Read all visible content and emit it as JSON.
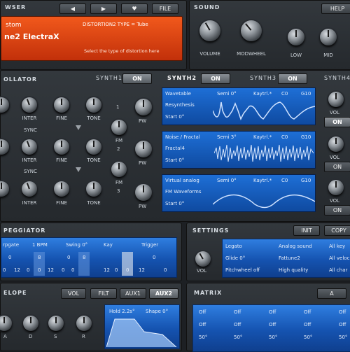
{
  "browser": {
    "title": "WSER",
    "back_label": "◀",
    "forward_label": "▶",
    "heart_label": "♥",
    "file_label": "FILE",
    "preset_category": "stom",
    "preset_name": "ne2 ElectraX",
    "param_text": "DISTORTION2 TYPE = Tube",
    "hint_text": "Select the type of distortion here"
  },
  "sound": {
    "title": "SOUND",
    "help_label": "HELP",
    "knobs": [
      "VOLUME",
      "MODWHEEL",
      "LOW",
      "MID"
    ]
  },
  "oscillator": {
    "title": "OLLATOR",
    "synth_tabs": [
      {
        "label": "SYNTH1",
        "state": "ON"
      },
      {
        "label": "SYNTH2",
        "state": "ON"
      },
      {
        "label": "SYNTH3",
        "state": "ON"
      },
      {
        "label": "SYNTH4",
        "state": ""
      }
    ],
    "rows": [
      {
        "knobs": [
          "INTER",
          "FINE",
          "TONE"
        ]
      },
      {
        "sync": "SYNC",
        "knobs": [
          "INTER",
          "FINE",
          "TONE"
        ]
      },
      {
        "sync": "SYNC",
        "knobs": [
          "INTER",
          "FINE",
          "TONE"
        ]
      }
    ],
    "pw_label": "PW",
    "fm_labels": [
      "FM\n2",
      "FM\n3"
    ],
    "fm_numbers": [
      "1",
      "2",
      "3"
    ],
    "osc_panels": [
      {
        "type": "Wavetable",
        "semi": "Semi 0°",
        "keytrk": "Kaytrl.*",
        "c0": "C0",
        "g10": "G10",
        "name": "Resynthesis",
        "start": "Start 0°"
      },
      {
        "type": "Noise / Fractal",
        "semi": "Semi 3°",
        "keytrk": "Kaytrl.*",
        "c0": "C0",
        "g10": "G10",
        "name": "Fractal4",
        "start": "Start 0°"
      },
      {
        "type": "Virtual analog",
        "semi": "Semi 0°",
        "keytrk": "Kaytrl.*",
        "c0": "C0",
        "g10": "G10",
        "name": "FM Waveforms",
        "start": "Start 0°"
      }
    ],
    "vol_label": "VOL",
    "on_label": "ON"
  },
  "arpeggiator": {
    "title": "PEGGIATOR",
    "headers": [
      "rpgate",
      "1 BPM",
      "Swing 0°",
      "Kay",
      "Trigger"
    ],
    "row1": [
      "0",
      "8",
      "0",
      "8",
      "0"
    ],
    "row2": [
      "0",
      "12",
      "0",
      "0",
      "12",
      "0",
      "0",
      "12",
      "0",
      "0",
      "12",
      "0"
    ]
  },
  "settings": {
    "title": "SETTINGS",
    "init_label": "INIT",
    "copy_label": "COPY",
    "vol_label": "VOL",
    "rows": [
      [
        "Legato",
        "Analog sound",
        "All key"
      ],
      [
        "Glide 0°",
        "Fattune2",
        "All veloc"
      ],
      [
        "Pitchwheel off",
        "High quality",
        "All char"
      ]
    ]
  },
  "envelope": {
    "title": "ELOPE",
    "tabs": [
      "VOL",
      "FILT",
      "AUX1",
      "AUX2"
    ],
    "knobs": [
      "A",
      "D",
      "S",
      "R"
    ],
    "hold": "Hold 2.2s°",
    "shape": "Shape 0°"
  },
  "matrix": {
    "title": "MATRIX",
    "a_label": "A",
    "rows": [
      [
        "Off",
        "Off",
        "Off",
        "Off",
        "Off"
      ],
      [
        "Off",
        "Off",
        "Off",
        "Off",
        "Off"
      ],
      [
        "50°",
        "50°",
        "50°",
        "50°",
        "50°"
      ]
    ]
  },
  "colors": {
    "accent_blue": "#1e6fd6",
    "browser_orange": "#e0400a",
    "panel_dark": "#25292d"
  }
}
